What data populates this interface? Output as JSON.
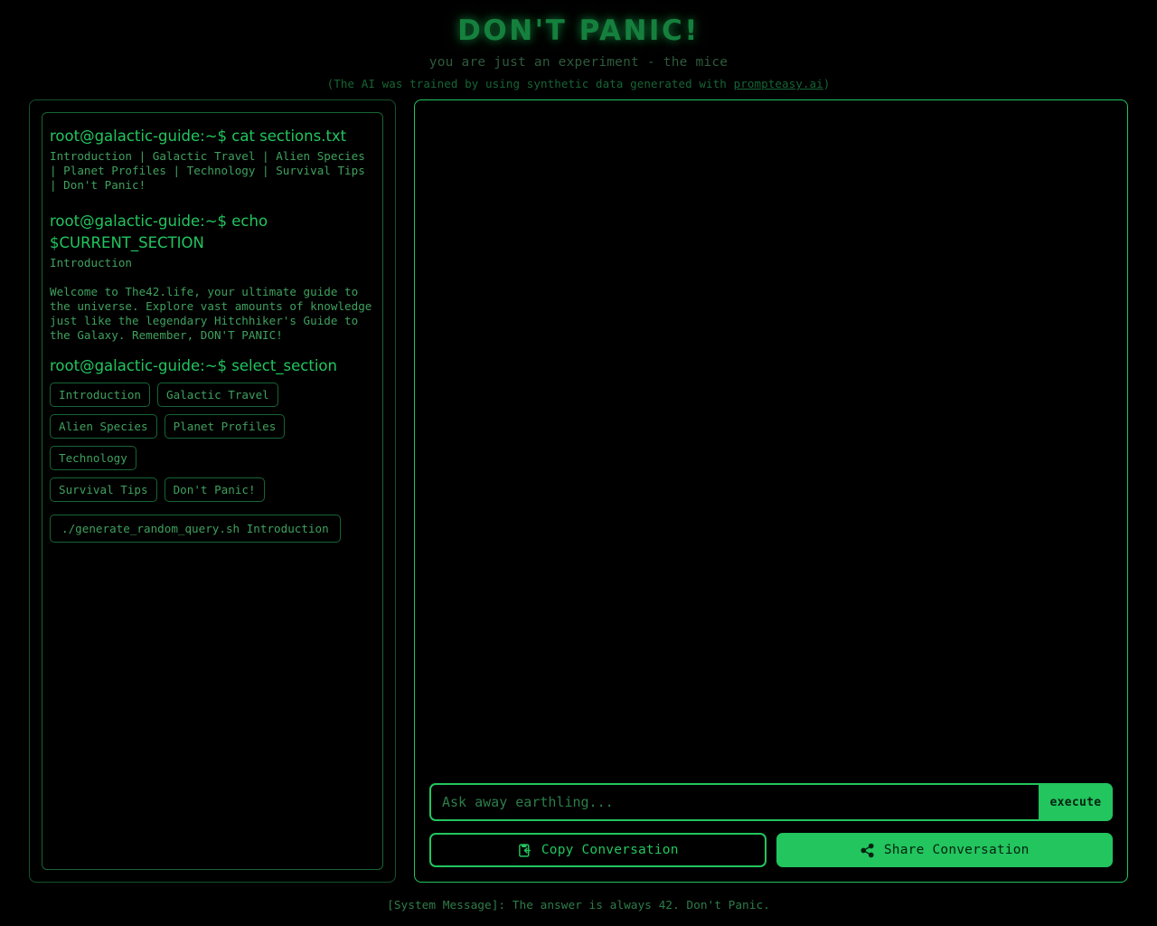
{
  "header": {
    "title": "DON'T PANIC!",
    "subtitle": "you are just an experiment - the mice",
    "credit_prefix": "(The AI was trained by using synthetic data generated with ",
    "credit_link": "prompteasy.ai",
    "credit_suffix": ")"
  },
  "terminal": {
    "prompt_cat": "root@galactic-guide:~$ cat sections.txt",
    "sections_list": "Introduction | Galactic Travel | Alien Species | Planet Profiles | Technology | Survival Tips | Don't Panic!",
    "prompt_echo": "root@galactic-guide:~$ echo $CURRENT_SECTION",
    "current_section": "Introduction",
    "welcome_text": "Welcome to The42.life, your ultimate guide to the universe. Explore vast amounts of knowledge just like the legendary Hitchhiker's Guide to the Galaxy. Remember, DON'T PANIC!",
    "prompt_select": "root@galactic-guide:~$ select_section",
    "section_buttons": [
      "Introduction",
      "Galactic Travel",
      "Alien Species",
      "Planet Profiles",
      "Technology",
      "Survival Tips",
      "Don't Panic!"
    ],
    "random_query_button": "./generate_random_query.sh Introduction"
  },
  "chat": {
    "messages": [],
    "input_value": "",
    "input_placeholder": "Ask away earthling...",
    "execute_label": "execute",
    "copy_label": "Copy Conversation",
    "copy_icon": "clipboard-copy-icon",
    "share_label": "Share Conversation",
    "share_icon": "share-nodes-icon"
  },
  "footer": {
    "system_message": "[System Message]: The answer is always 42. Don't Panic."
  },
  "colors": {
    "accent": "#22c55e",
    "title": "#15803d",
    "border_dim": "#166534",
    "panel_border_dim": "#14532d",
    "text_body": "#3fa05e",
    "background": "#000000"
  }
}
